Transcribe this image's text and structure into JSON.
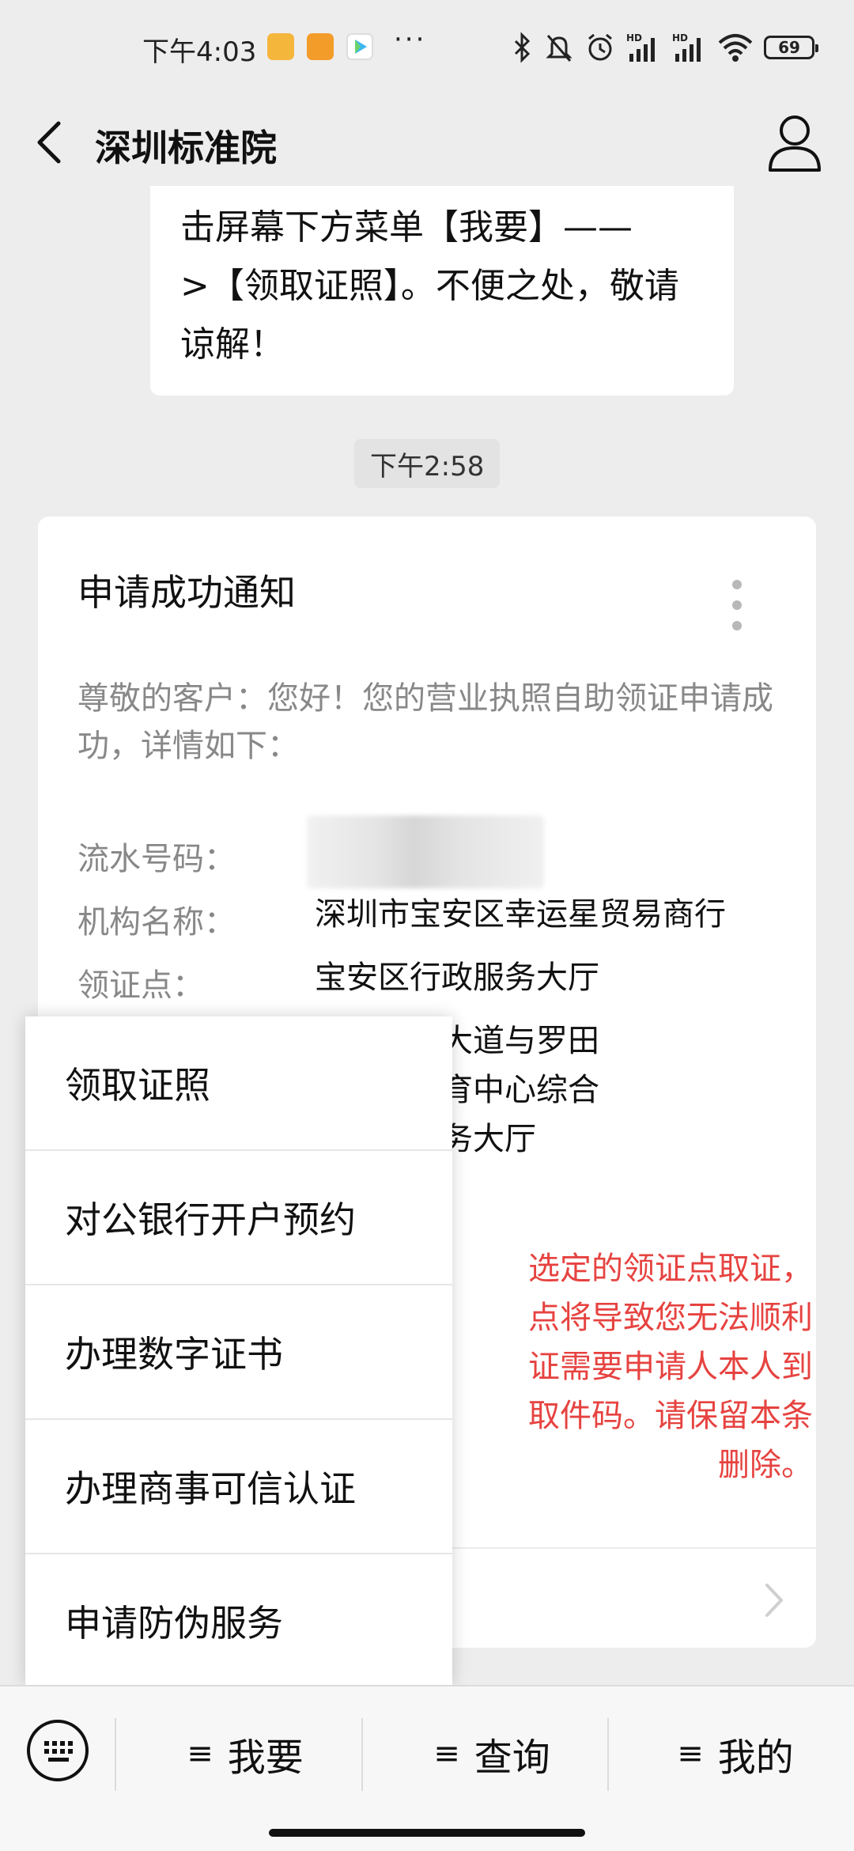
{
  "status_bar": {
    "time": "下午4:03",
    "more_glyph": "···",
    "battery": "69",
    "app_icons": [
      {
        "name": "notes-app",
        "color": "#f5b63c"
      },
      {
        "name": "radio-app",
        "color": "#f39c2a"
      },
      {
        "name": "video-app",
        "color": "#3bb7f0"
      }
    ],
    "indicators": [
      "bluetooth-icon",
      "mute-icon",
      "alarm-icon",
      "hd-signal-icon",
      "hd-signal-icon",
      "wifi-icon"
    ]
  },
  "header": {
    "title": "深圳标准院",
    "back_icon": "chevron-left-icon",
    "profile_icon": "person-icon"
  },
  "chat": {
    "previous_message": "寻在线服务。【领取证照】请点\n击屏幕下方菜单【我要】——\n>【领取证照】。不便之处，敬请\n谅解！",
    "timestamp": "下午2:58",
    "card": {
      "title": "申请成功通知",
      "more_icon": "vertical-dots-icon",
      "intro": "尊敬的客户：您好！您的营业执照自助领证申请成功，详情如下：",
      "fields": [
        {
          "label": "流水号码：",
          "value": ""
        },
        {
          "label": "机构名称：",
          "value": "深圳市宝安区幸运星贸易商行"
        },
        {
          "label": "领证点：",
          "value": "宝安区行政服务大厅"
        }
      ],
      "address_visible": "安区宝安大道与罗田\n宝安区体育中心综合\n楼行政服务大厅",
      "warning_visible": "选定的领证点取证，\n点将导致您无法顺利\n证需要申请人本人到\n取件码。请保留本条\n删除。"
    }
  },
  "popup_menu": {
    "items": [
      "领取证照",
      "对公银行开户预约",
      "办理数字证书",
      "办理商事可信认证",
      "申请防伪服务"
    ]
  },
  "bottom_menu": {
    "keyboard_icon": "keyboard-icon",
    "tabs": [
      {
        "glyph": "≡",
        "label": "我要"
      },
      {
        "glyph": "≡",
        "label": "查询"
      },
      {
        "glyph": "≡",
        "label": "我的"
      }
    ]
  },
  "colors": {
    "background": "#ededed",
    "card": "#ffffff",
    "warning_red": "#e64340",
    "muted_gray": "#888888"
  }
}
